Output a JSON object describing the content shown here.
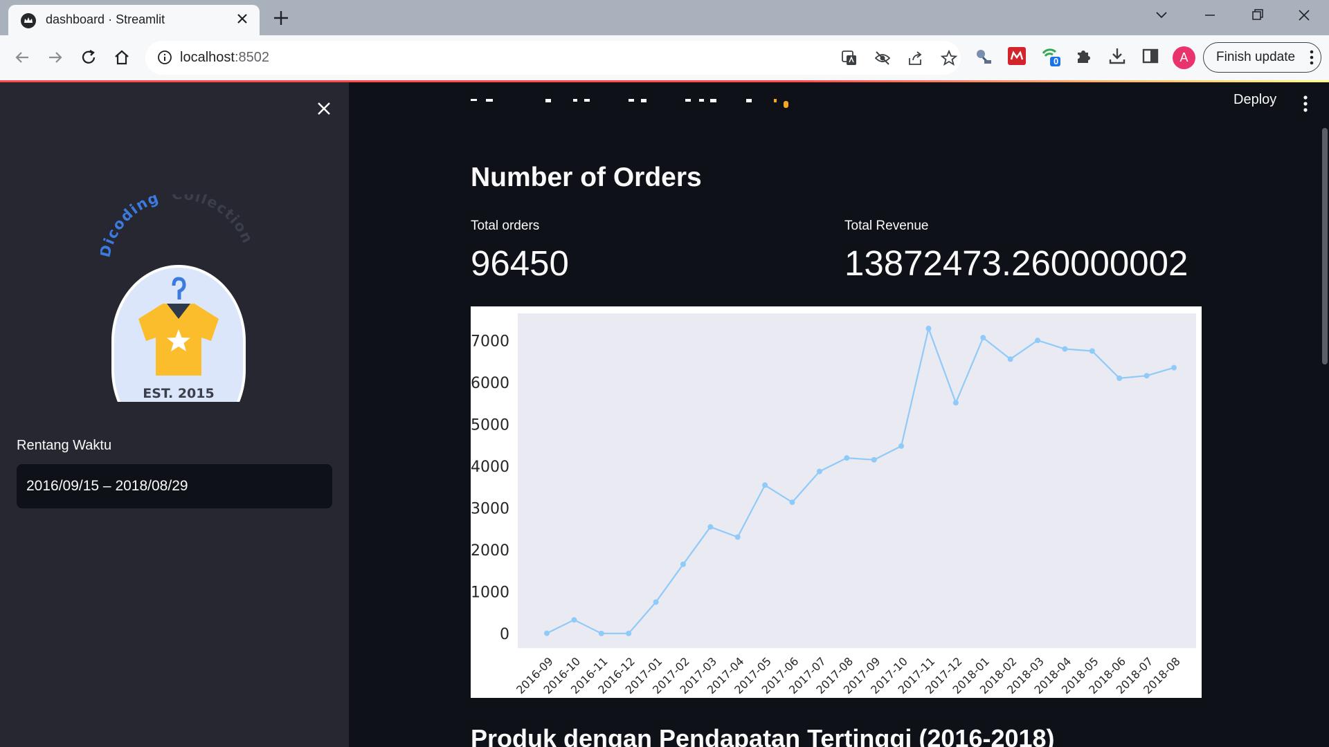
{
  "browser": {
    "tab_title": "dashboard · Streamlit",
    "url_host": "localhost",
    "url_port": ":8502",
    "profile_initial": "A",
    "finish_update_label": "Finish update",
    "extension_badge": "0"
  },
  "sidebar": {
    "logo": {
      "arc_text_1": "Dicoding",
      "arc_text_2": "Collection",
      "est_text": "EST. 2015"
    },
    "date_range_label": "Rentang Waktu",
    "date_range_value": "2016/09/15 – 2018/08/29"
  },
  "header": {
    "deploy_label": "Deploy"
  },
  "main": {
    "section_title": "Number of Orders",
    "metrics": [
      {
        "label": "Total orders",
        "value": "96450"
      },
      {
        "label": "Total Revenue",
        "value": "13872473.260000002"
      }
    ],
    "next_section_title": "Produk dengan Pendapatan Tertinggi (2016-2018)"
  },
  "colors": {
    "line": "#90caf9",
    "plot_bg": "#eaeaf2",
    "app_bg": "#0e1117",
    "sidebar_bg": "#262730"
  },
  "chart_data": {
    "type": "line",
    "x": [
      "2016-09",
      "2016-10",
      "2016-11",
      "2016-12",
      "2017-01",
      "2017-02",
      "2017-03",
      "2017-04",
      "2017-05",
      "2017-06",
      "2017-07",
      "2017-08",
      "2017-09",
      "2017-10",
      "2017-11",
      "2017-12",
      "2018-01",
      "2018-02",
      "2018-03",
      "2018-04",
      "2018-05",
      "2018-06",
      "2018-07",
      "2018-08"
    ],
    "values": [
      4,
      324,
      0,
      1,
      750,
      1653,
      2546,
      2303,
      3545,
      3135,
      3872,
      4193,
      4150,
      4478,
      7288,
      5513,
      7069,
      6555,
      7003,
      6798,
      6749,
      6099,
      6159,
      6351
    ],
    "yticks": [
      0,
      1000,
      2000,
      3000,
      4000,
      5000,
      6000,
      7000
    ],
    "ylim": [
      -350,
      7650
    ],
    "grid": false,
    "title": "",
    "xlabel": "",
    "ylabel": ""
  }
}
